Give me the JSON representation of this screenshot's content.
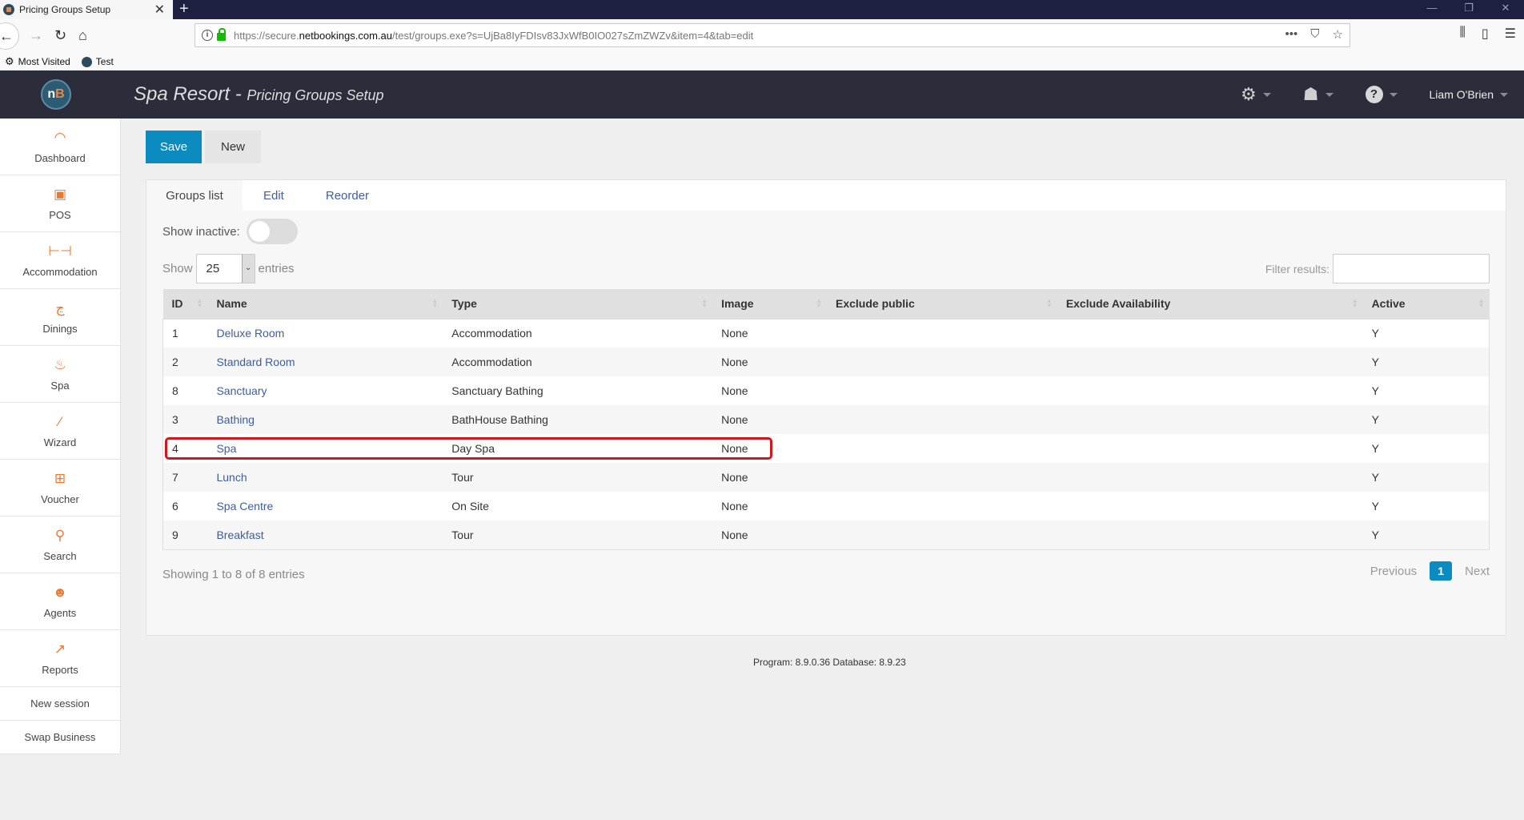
{
  "browser": {
    "tab_title": "Pricing Groups Setup",
    "url_prefix": "https://secure.",
    "url_domain": "netbookings.com.au",
    "url_suffix": "/test/groups.exe?s=UjBa8IyFDIsv83JxWfB0IO027sZmZWZv&item=4&tab=edit",
    "bookmarks": [
      "Most Visited",
      "Test"
    ]
  },
  "header": {
    "logo": "nB",
    "business": "Spa Resort",
    "separator": " - ",
    "page": "Pricing Groups Setup",
    "user": "Liam O'Brien"
  },
  "sidebar": {
    "items": [
      {
        "label": "Dashboard",
        "icon": "dashboard-icon"
      },
      {
        "label": "POS",
        "icon": "pos-icon"
      },
      {
        "label": "Accommodation",
        "icon": "bed-icon"
      },
      {
        "label": "Dinings",
        "icon": "dining-icon"
      },
      {
        "label": "Spa",
        "icon": "spa-icon"
      },
      {
        "label": "Wizard",
        "icon": "wand-icon"
      },
      {
        "label": "Voucher",
        "icon": "gift-icon"
      },
      {
        "label": "Search",
        "icon": "search-icon"
      },
      {
        "label": "Agents",
        "icon": "agent-icon"
      },
      {
        "label": "Reports",
        "icon": "chart-icon"
      }
    ],
    "new_session": "New session",
    "swap_business": "Swap Business"
  },
  "toolbar": {
    "save_label": "Save",
    "new_label": "New"
  },
  "tabs": [
    {
      "label": "Groups list",
      "active": true
    },
    {
      "label": "Edit",
      "active": false
    },
    {
      "label": "Reorder",
      "active": false
    }
  ],
  "filters": {
    "show_inactive_label": "Show inactive:",
    "show_inactive": false,
    "show_label": "Show",
    "entries_value": "25",
    "entries_label": "entries",
    "filter_label": "Filter results:",
    "filter_value": ""
  },
  "table": {
    "columns": [
      "ID",
      "Name",
      "Type",
      "Image",
      "Exclude public",
      "Exclude Availability",
      "Active"
    ],
    "rows": [
      {
        "id": "1",
        "name": "Deluxe Room",
        "type": "Accommodation",
        "image": "None",
        "exclude_public": "",
        "exclude_availability": "",
        "active": "Y"
      },
      {
        "id": "2",
        "name": "Standard Room",
        "type": "Accommodation",
        "image": "None",
        "exclude_public": "",
        "exclude_availability": "",
        "active": "Y"
      },
      {
        "id": "8",
        "name": "Sanctuary",
        "type": "Sanctuary Bathing",
        "image": "None",
        "exclude_public": "",
        "exclude_availability": "",
        "active": "Y"
      },
      {
        "id": "3",
        "name": "Bathing",
        "type": "BathHouse Bathing",
        "image": "None",
        "exclude_public": "",
        "exclude_availability": "",
        "active": "Y"
      },
      {
        "id": "4",
        "name": "Spa",
        "type": "Day Spa",
        "image": "None",
        "exclude_public": "",
        "exclude_availability": "",
        "active": "Y"
      },
      {
        "id": "7",
        "name": "Lunch",
        "type": "Tour",
        "image": "None",
        "exclude_public": "",
        "exclude_availability": "",
        "active": "Y"
      },
      {
        "id": "6",
        "name": "Spa Centre",
        "type": "On Site",
        "image": "None",
        "exclude_public": "",
        "exclude_availability": "",
        "active": "Y"
      },
      {
        "id": "9",
        "name": "Breakfast",
        "type": "Tour",
        "image": "None",
        "exclude_public": "",
        "exclude_availability": "",
        "active": "Y"
      }
    ],
    "highlighted_row_id": "4"
  },
  "pagination": {
    "info": "Showing 1 to 8 of 8 entries",
    "previous": "Previous",
    "current": "1",
    "next": "Next"
  },
  "footer": {
    "version": "Program: 8.9.0.36 Database: 8.9.23"
  },
  "colors": {
    "accent": "#0b8bbf",
    "icon_orange": "#e87a32",
    "link": "#3d5e9a",
    "header_bg": "#2b2d3a",
    "highlight": "#d0161e"
  }
}
